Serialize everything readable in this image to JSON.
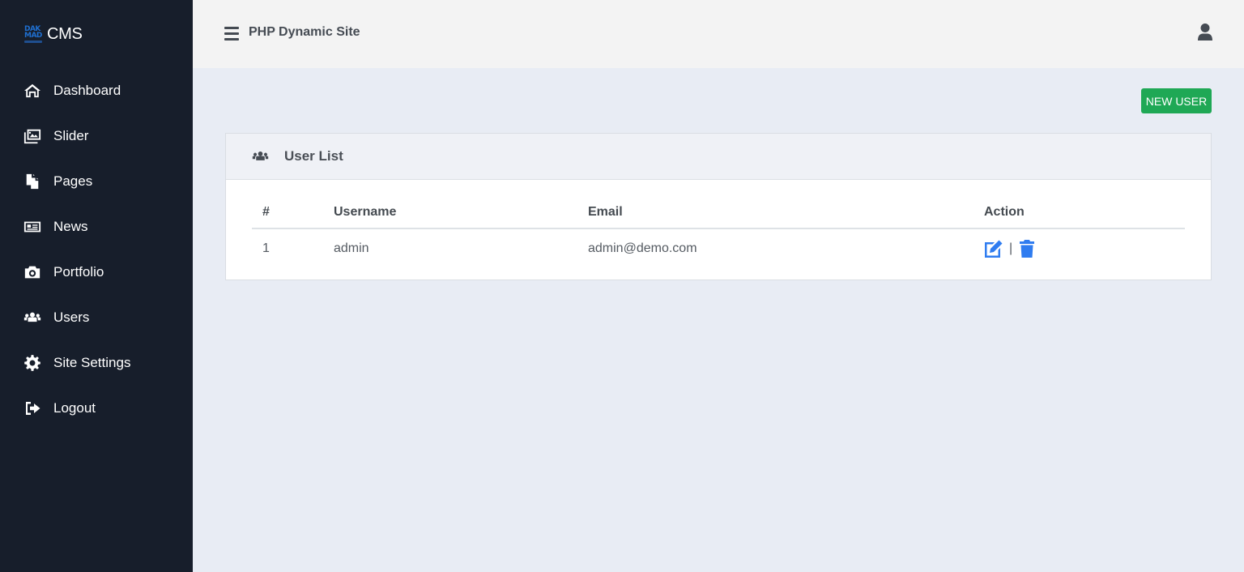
{
  "brand": {
    "logo_lines": [
      "DAK",
      "MAD"
    ],
    "name": "CMS"
  },
  "sidebar": {
    "items": [
      {
        "label": "Dashboard",
        "icon": "home-icon"
      },
      {
        "label": "Slider",
        "icon": "images-icon"
      },
      {
        "label": "Pages",
        "icon": "copy-icon"
      },
      {
        "label": "News",
        "icon": "newspaper-icon"
      },
      {
        "label": "Portfolio",
        "icon": "camera-icon"
      },
      {
        "label": "Users",
        "icon": "users-icon"
      },
      {
        "label": "Site Settings",
        "icon": "cog-icon"
      },
      {
        "label": "Logout",
        "icon": "sign-out-icon"
      }
    ]
  },
  "header": {
    "title": "PHP Dynamic Site",
    "menu_icon": "hamburger-icon",
    "user_icon": "user-icon"
  },
  "main": {
    "new_user_label": "NEW USER",
    "card": {
      "title": "User List",
      "icon": "users-icon",
      "columns": [
        "#",
        "Username",
        "Email",
        "Action"
      ],
      "rows": [
        {
          "num": "1",
          "username": "admin",
          "email": "admin@demo.com",
          "action_separator": "|"
        }
      ]
    }
  },
  "colors": {
    "sidebar_bg": "#171e2b",
    "topbar_bg": "#f3f3f3",
    "content_bg": "#e8ecf4",
    "success": "#1fa855",
    "action_blue": "#2f7cf0"
  }
}
